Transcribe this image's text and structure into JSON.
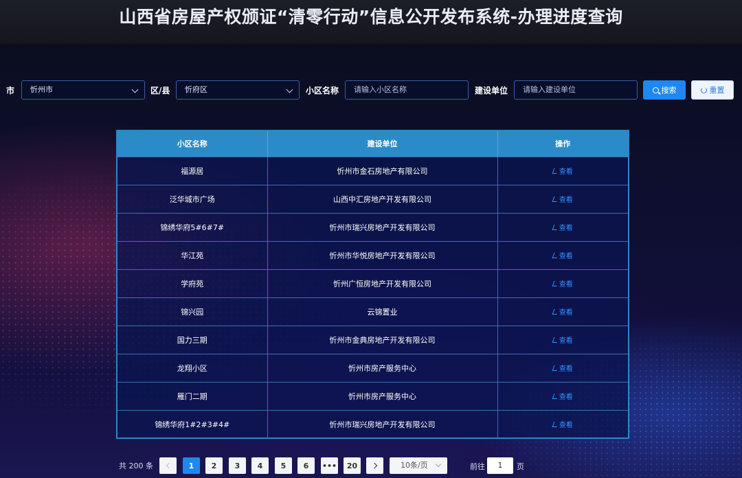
{
  "header": {
    "title": "山西省房屋产权颁证“清零行动”信息公开发布系统-办理进度查询"
  },
  "filters": {
    "city_label": "市",
    "city_value": "忻州市",
    "district_label": "区/县",
    "district_value": "忻府区",
    "community_label": "小区名称",
    "community_placeholder": "请输入小区名称",
    "builder_label": "建设单位",
    "builder_placeholder": "请输入建设单位",
    "search_label": "搜索",
    "reset_label": "重置"
  },
  "table": {
    "columns": [
      "小区名称",
      "建设单位",
      "操作"
    ],
    "action_label": "查看",
    "rows": [
      {
        "name": "福源居",
        "builder": "忻州市金石房地产有限公司"
      },
      {
        "name": "泛华城市广场",
        "builder": "山西中汇房地产开发有限公司"
      },
      {
        "name": "锦绣华府5#6#7#",
        "builder": "忻州市瑞兴房地产开发有限公司"
      },
      {
        "name": "华江苑",
        "builder": "忻州市华悦房地产开发有限公司"
      },
      {
        "name": "学府苑",
        "builder": "忻州广恒房地产开发有限公司"
      },
      {
        "name": "锦兴园",
        "builder": "云锦置业"
      },
      {
        "name": "国力三期",
        "builder": "忻州市金典房地产开发有限公司"
      },
      {
        "name": "龙翔小区",
        "builder": "忻州市房产服务中心"
      },
      {
        "name": "雁门二期",
        "builder": "忻州市房产服务中心"
      },
      {
        "name": "锦绣华府1#2#3#4#",
        "builder": "忻州市瑞兴房地产开发有限公司"
      }
    ]
  },
  "pagination": {
    "total_text": "共 200 条",
    "pages": [
      "1",
      "2",
      "3",
      "4",
      "5",
      "6",
      "•••",
      "20"
    ],
    "current_page": "1",
    "page_size": "10条/页",
    "goto_prefix": "前往",
    "goto_value": "1",
    "goto_suffix": "页"
  },
  "colors": {
    "accent": "#1e88f0",
    "table_header": "#2b8bc8",
    "link": "#2f93ff"
  }
}
